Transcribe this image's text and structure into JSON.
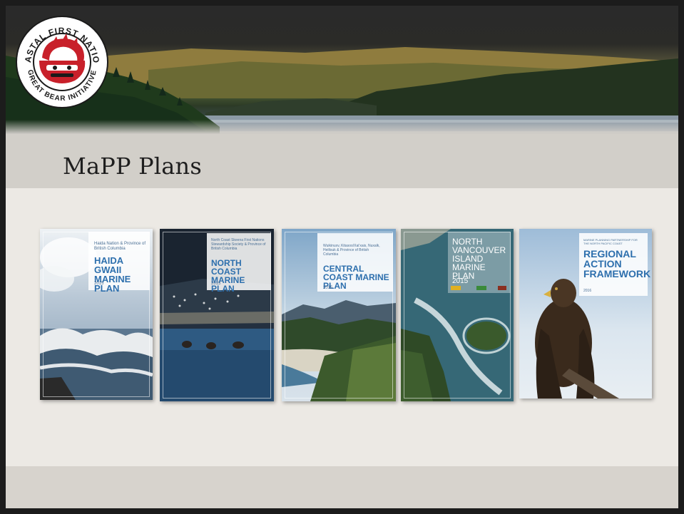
{
  "slide": {
    "title": "MaPP Plans"
  },
  "logo": {
    "top_text": "COASTAL FIRST NATIONS",
    "bottom_text": "GREAT BEAR INITIATIVE"
  },
  "covers": [
    {
      "subtitle": "Haida Nation & Province of British Columbia",
      "title": "HAIDA GWAII MARINE PLAN",
      "year": "2015"
    },
    {
      "subtitle": "North Coast Skeena First Nations Stewardship Society & Province of British Columbia",
      "title": "NORTH COAST MARINE PLAN",
      "year": "2015"
    },
    {
      "subtitle": "Wuikinuxv, Kitasoo/Xai'xais, Nuxalk, Heiltsuk & Province of British Columbia",
      "title": "CENTRAL COAST MARINE PLAN",
      "year": "2015"
    },
    {
      "subtitle": "",
      "title": "NORTH VANCOUVER ISLAND MARINE PLAN",
      "year": "2015"
    },
    {
      "subtitle": "MARINE PLANNING PARTNERSHIP FOR THE NORTH PACIFIC COAST",
      "title": "REGIONAL ACTION FRAMEWORK",
      "year": "2016"
    }
  ],
  "colors": {
    "cover_title": "#2d6fad",
    "title_band": "#d2cfc9",
    "background": "#ece9e4"
  }
}
